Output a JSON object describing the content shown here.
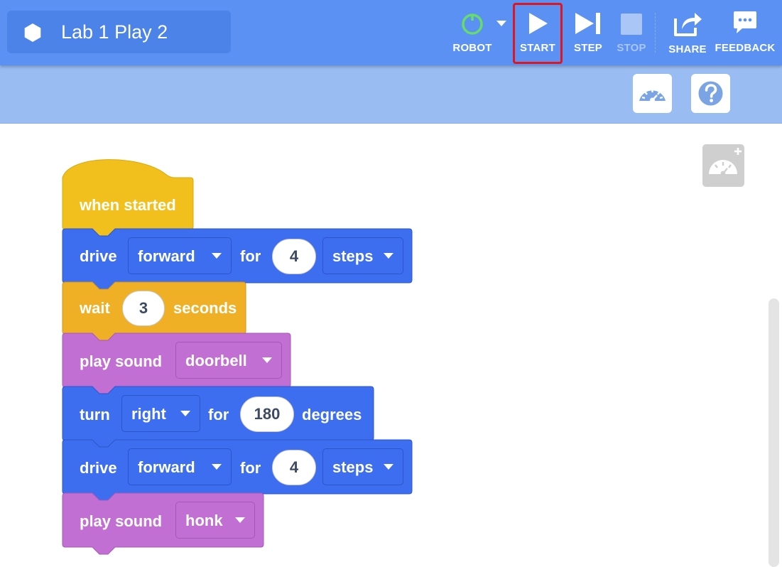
{
  "project": {
    "title": "Lab 1 Play 2",
    "icon": "hexagon-icon"
  },
  "toolbar": {
    "robot_label": "ROBOT",
    "start_label": "START",
    "step_label": "STEP",
    "stop_label": "STOP",
    "share_label": "SHARE",
    "feedback_label": "FEEDBACK"
  },
  "colors": {
    "toolbar": "#5a91f2",
    "subbar": "#99bcf2",
    "drive_block": "#3d6ef0",
    "event_block": "#f2c01c",
    "wait_block": "#f0b025",
    "sound_block": "#c26fd3",
    "highlight": "#e0161f"
  },
  "blocks": {
    "b0": {
      "text": "when started"
    },
    "b1": {
      "verb": "drive",
      "direction": "forward",
      "for_label": "for",
      "amount": "4",
      "unit": "steps"
    },
    "b2": {
      "verb": "wait",
      "amount": "3",
      "unit": "seconds"
    },
    "b3": {
      "verb": "play sound",
      "sound": "doorbell"
    },
    "b4": {
      "verb": "turn",
      "direction": "right",
      "for_label": "for",
      "amount": "180",
      "unit": "degrees"
    },
    "b5": {
      "verb": "drive",
      "direction": "forward",
      "for_label": "for",
      "amount": "4",
      "unit": "steps"
    },
    "b6": {
      "verb": "play sound",
      "sound": "honk"
    }
  }
}
